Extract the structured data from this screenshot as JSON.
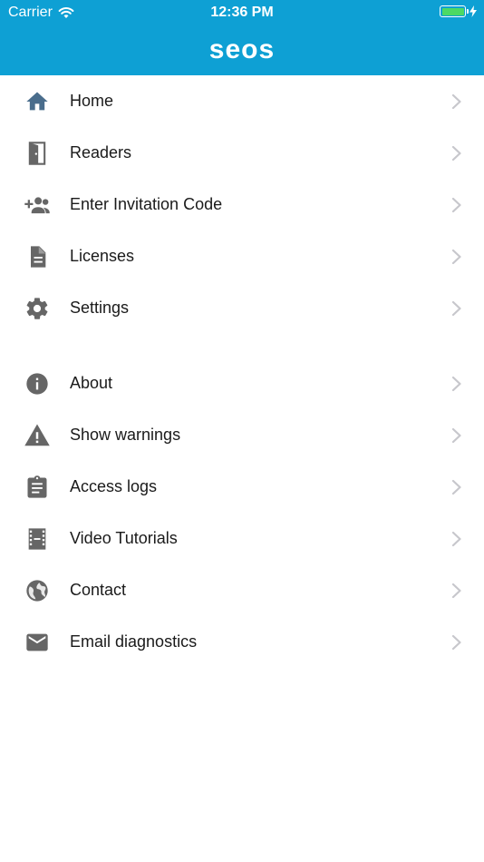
{
  "status_bar": {
    "carrier": "Carrier",
    "time": "12:36 PM",
    "battery_level": 1.0
  },
  "header": {
    "logo_text": "seos"
  },
  "colors": {
    "header": "#0ea0d4",
    "home_icon": "#4a6d8c",
    "icon": "#666666",
    "chevron": "#c7c7cc",
    "battery": "#4cd964"
  },
  "menu": {
    "section1": [
      {
        "label": "Home",
        "icon": "home-icon"
      },
      {
        "label": "Readers",
        "icon": "door-icon"
      },
      {
        "label": "Enter Invitation Code",
        "icon": "group-add-icon"
      },
      {
        "label": "Licenses",
        "icon": "document-icon"
      },
      {
        "label": "Settings",
        "icon": "gear-icon"
      }
    ],
    "section2": [
      {
        "label": "About",
        "icon": "info-icon"
      },
      {
        "label": "Show warnings",
        "icon": "warning-icon"
      },
      {
        "label": "Access logs",
        "icon": "clipboard-icon"
      },
      {
        "label": "Video Tutorials",
        "icon": "film-icon"
      },
      {
        "label": "Contact",
        "icon": "globe-icon"
      },
      {
        "label": "Email diagnostics",
        "icon": "email-icon"
      }
    ]
  }
}
